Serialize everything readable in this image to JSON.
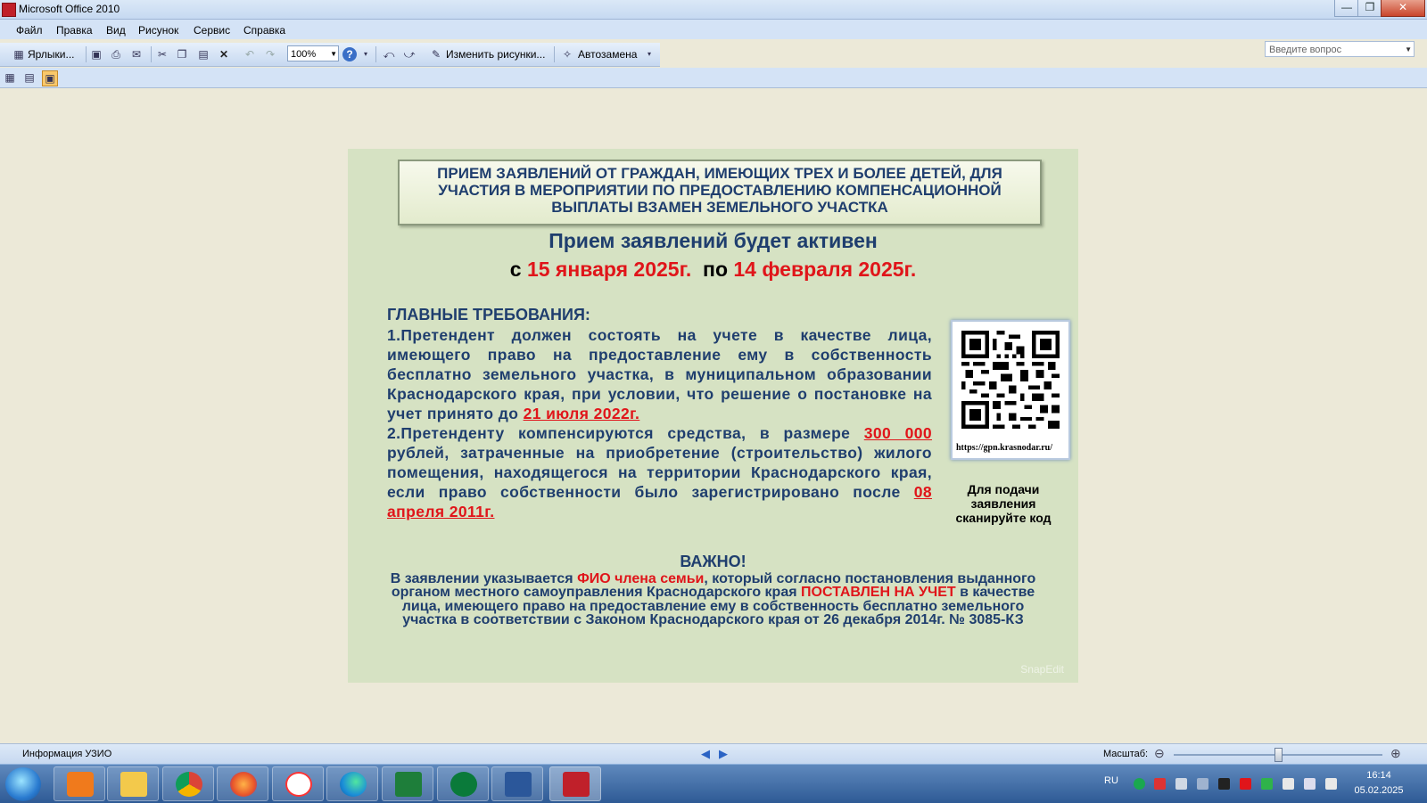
{
  "window": {
    "title": "Microsoft Office 2010",
    "minimize": "—",
    "maximize": "❐",
    "close": "✕"
  },
  "menu": {
    "items": [
      "Файл",
      "Правка",
      "Вид",
      "Рисунок",
      "Сервис",
      "Справка"
    ],
    "ask_placeholder": "Введите вопрос"
  },
  "toolbar": {
    "shortcuts": "Ярлыки...",
    "zoom": "100%",
    "edit_pictures": "Изменить рисунки...",
    "autocorrect": "Автозамена"
  },
  "slide": {
    "header": "ПРИЕМ ЗАЯВЛЕНИЙ ОТ ГРАЖДАН, ИМЕЮЩИХ ТРЕХ И БОЛЕЕ ДЕТЕЙ, ДЛЯ УЧАСТИЯ В МЕРОПРИЯТИИ ПО ПРЕДОСТАВЛЕНИЮ КОМПЕНСАЦИОННОЙ ВЫПЛАТЫ ВЗАМЕН ЗЕМЕЛЬНОГО УЧАСТКА",
    "active": "Прием заявлений будет активен",
    "from_word": "с ",
    "from_date": "15 января 2025г.",
    "to_word": "  по ",
    "to_date": "14 февраля 2025г.",
    "req_heading": "ГЛАВНЫЕ ТРЕБОВАНИЯ:",
    "req1": "1.Претендент должен состоять на учете в качестве лица, имеющего право на предоставление ему в собственность бесплатно земельного участка, в муниципальном образовании Краснодарского края, при условии, что решение о постановке на учет принято до ",
    "req1_date": "21 июля 2022г.",
    "req2_start": "2.Претенденту компенсируются средства, в размере ",
    "req2_amount": "300 000",
    "req2_mid": " рублей, затраченные на приобретение (строительство) жилого помещения, находящегося на территории Краснодарского края, если право собственности было зарегистрировано после ",
    "req2_date": "08 апреля 2011г.",
    "qr_url": "https://gpn.krasnodar.ru/",
    "qr_caption": "Для подачи заявления сканируйте код",
    "important_title": "ВАЖНО!",
    "imp_1": "В заявлении указывается ",
    "imp_red1": "ФИО члена семьи",
    "imp_2": ", который согласно постановления выданного органом местного самоуправления Краснодарского края ",
    "imp_red2": "ПОСТАВЛЕН НА УЧЕТ",
    "imp_3": " в качестве лица, имеющего право на предоставление ему в собственность бесплатно земельного участка в соответствии с Законом Краснодарского края от 26 декабря 2014г. № 3085-КЗ",
    "watermark": "SnapEdit"
  },
  "status": {
    "info": "Информация УЗИО",
    "zoom_label": "Масштаб:"
  },
  "tray": {
    "lang": "RU",
    "time": "16:14",
    "date": "05.02.2025"
  },
  "icons": {
    "app": "office-picture-manager-icon",
    "start": "windows-start-icon"
  }
}
